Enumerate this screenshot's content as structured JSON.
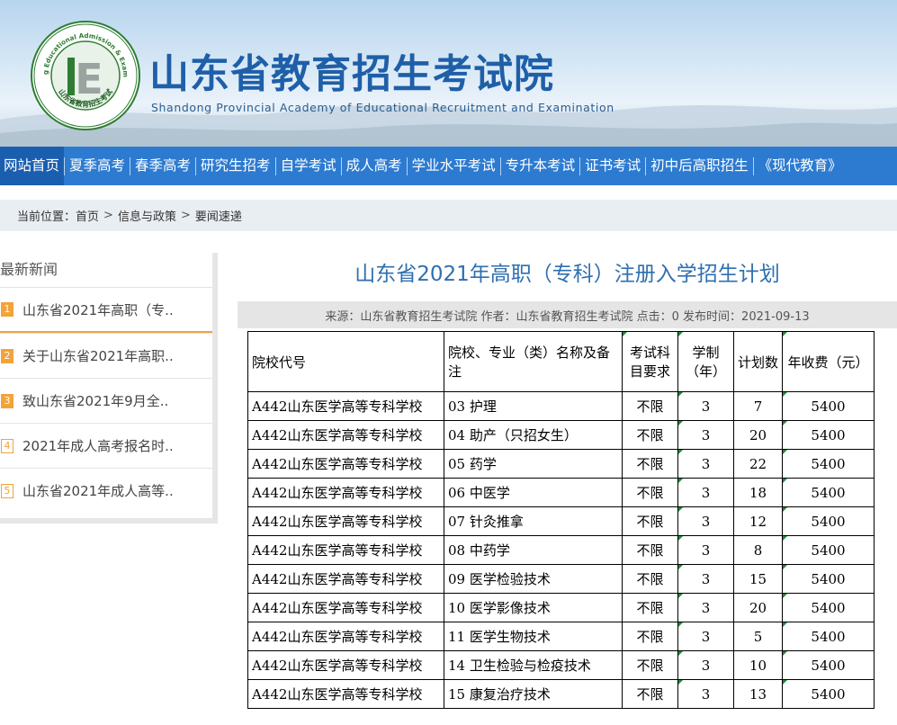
{
  "header": {
    "title": "山东省教育招生考试院",
    "subtitle": "Shandong Provincial Academy of Educational Recruitment and Examination",
    "logo_ring_en": "Shandong Educational Admission & Examinations",
    "logo_ring_cn": "山东省教育招生考试",
    "logo_letter": "E"
  },
  "nav": {
    "items": [
      {
        "label": "网站首页"
      },
      {
        "label": "夏季高考"
      },
      {
        "label": "春季高考"
      },
      {
        "label": "研究生招考"
      },
      {
        "label": "自学考试"
      },
      {
        "label": "成人高考"
      },
      {
        "label": "学业水平考试"
      },
      {
        "label": "专升本考试"
      },
      {
        "label": "证书考试"
      },
      {
        "label": "初中后高职招生"
      },
      {
        "label": "《现代教育》"
      }
    ]
  },
  "breadcrumb": {
    "lead": "当前位置：",
    "items": [
      "首页",
      "信息与政策",
      "要闻速递"
    ],
    "separator": ">"
  },
  "sidebar": {
    "title": "最新新闻",
    "items": [
      {
        "num": "1",
        "label": "山东省2021年高职（专.."
      },
      {
        "num": "2",
        "label": "关于山东省2021年高职.."
      },
      {
        "num": "3",
        "label": "致山东省2021年9月全.."
      },
      {
        "num": "4",
        "label": "2021年成人高考报名时.."
      },
      {
        "num": "5",
        "label": "山东省2021年成人高等.."
      }
    ]
  },
  "article": {
    "title": "山东省2021年高职（专科）注册入学招生计划",
    "meta": "来源：山东省教育招生考试院  作者：山东省教育招生考试院  点击：0  发布时间：2021-09-13"
  },
  "table": {
    "headers": [
      "院校代号",
      "院校、专业（类）名称及备注",
      "考试科目要求",
      "学制（年）",
      "计划数",
      "年收费（元）"
    ],
    "rows": [
      [
        "A442山东医学高等专科学校",
        "03 护理",
        "不限",
        "3",
        "7",
        "5400"
      ],
      [
        "A442山东医学高等专科学校",
        "04 助产（只招女生）",
        "不限",
        "3",
        "20",
        "5400"
      ],
      [
        "A442山东医学高等专科学校",
        "05 药学",
        "不限",
        "3",
        "22",
        "5400"
      ],
      [
        "A442山东医学高等专科学校",
        "06 中医学",
        "不限",
        "3",
        "18",
        "5400"
      ],
      [
        "A442山东医学高等专科学校",
        "07 针灸推拿",
        "不限",
        "3",
        "12",
        "5400"
      ],
      [
        "A442山东医学高等专科学校",
        "08 中药学",
        "不限",
        "3",
        "8",
        "5400"
      ],
      [
        "A442山东医学高等专科学校",
        "09 医学检验技术",
        "不限",
        "3",
        "15",
        "5400"
      ],
      [
        "A442山东医学高等专科学校",
        "10 医学影像技术",
        "不限",
        "3",
        "20",
        "5400"
      ],
      [
        "A442山东医学高等专科学校",
        "11 医学生物技术",
        "不限",
        "3",
        "5",
        "5400"
      ],
      [
        "A442山东医学高等专科学校",
        "14 卫生检验与检疫技术",
        "不限",
        "3",
        "10",
        "5400"
      ],
      [
        "A442山东医学高等专科学校",
        "15 康复治疗技术",
        "不限",
        "3",
        "13",
        "5400"
      ]
    ]
  },
  "colors": {
    "nav_bg": "#2d7bd1",
    "nav_active_bg": "#1a5eaf",
    "title_blue": "#1f5fa8",
    "accent_orange": "#f2a33a",
    "logo_green": "#2f7d32"
  }
}
